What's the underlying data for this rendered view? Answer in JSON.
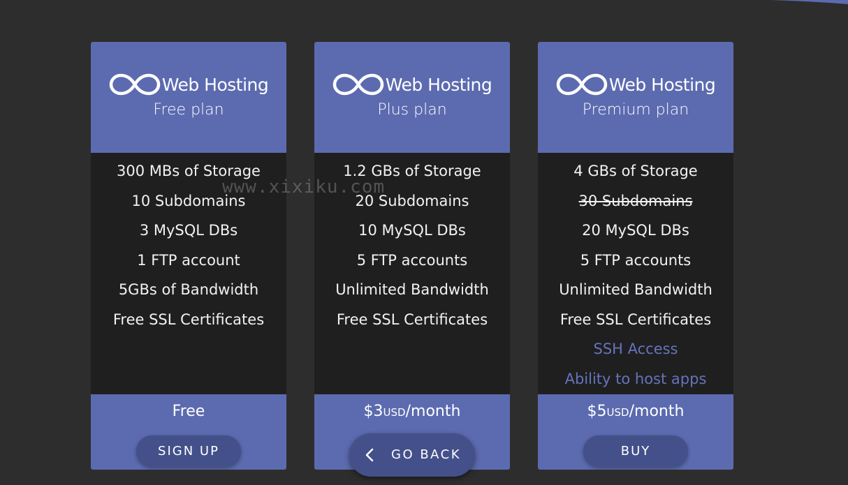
{
  "brand": {
    "name": "Web Hosting",
    "logo_icon": "infinity-icon"
  },
  "plans": [
    {
      "plan_name": "Free plan",
      "features": [
        "300 MBs of Storage",
        "10 Subdomains",
        "3 MySQL DBs",
        "1 FTP account",
        "5GBs of Bandwidth",
        "Free SSL Certificates"
      ],
      "price": {
        "amount": "Free",
        "currency": "",
        "period": ""
      },
      "action_label": "SIGN UP"
    },
    {
      "plan_name": "Plus plan",
      "features": [
        "1.2 GBs of Storage",
        "20 Subdomains",
        "10 MySQL DBs",
        "5 FTP accounts",
        "Unlimited Bandwidth",
        "Free SSL Certificates"
      ],
      "price": {
        "amount": "$3",
        "currency": "USD",
        "period": "/month"
      },
      "action_label": ""
    },
    {
      "plan_name": "Premium plan",
      "features": [
        "4 GBs of Storage",
        "30 Subdomains",
        "20 MySQL DBs",
        "5 FTP accounts",
        "Unlimited Bandwidth",
        "Free SSL Certificates"
      ],
      "extra_features": [
        "SSH Access",
        "Ability to host apps"
      ],
      "struck_feature": "30 Subdomains",
      "price": {
        "amount": "$5",
        "currency": "USD",
        "period": "/month"
      },
      "action_label": "BUY"
    }
  ],
  "watermark": "www.xixiku.com",
  "go_back": {
    "label": "GO BACK",
    "icon": "chevron-left-icon"
  },
  "colors": {
    "background": "#2d2d2d",
    "card_body": "#1f1f1f",
    "accent": "#5c6bb0",
    "button": "#43508a",
    "extra_feature": "#6673bd"
  }
}
